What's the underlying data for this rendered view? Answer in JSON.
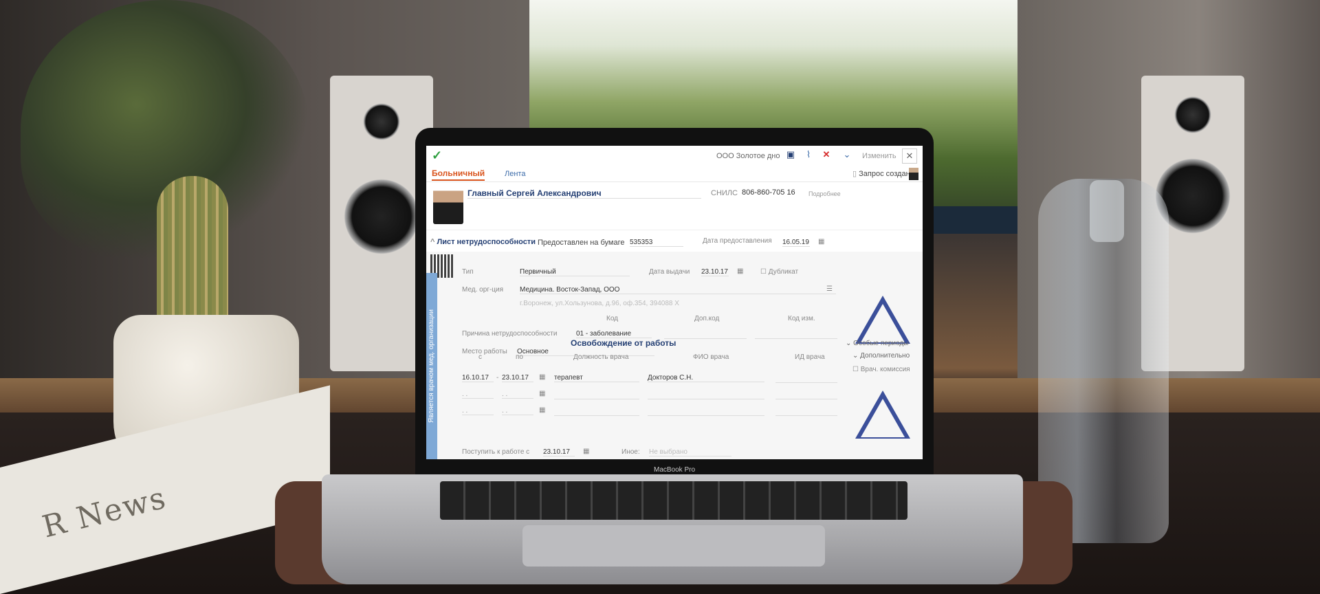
{
  "screen": {
    "toolbar": {
      "company": "ООО Золотое дно",
      "change_label": "Изменить"
    },
    "tabs": [
      {
        "label": "Больничный"
      },
      {
        "label": "Лента"
      }
    ],
    "status": "Запрос создан",
    "patient": {
      "name": "Главный Сергей Александрович",
      "snils_label": "СНИЛС",
      "snils_value": "806-860-705 16",
      "more_label": "Подробнее"
    },
    "sick_leave": {
      "section_title": "Лист нетрудоспособности",
      "paper_label": "Предоставлен на бумаге",
      "paper_value": "535353",
      "date_provided_label": "Дата предоставления",
      "date_provided_value": "16.05.19",
      "type_label": "Тип",
      "type_value": "Первичный",
      "issue_date_label": "Дата выдачи",
      "issue_date_value": "23.10.17",
      "duplicate_label": "Дубликат",
      "med_org_label": "Мед. орг-ция",
      "med_org_value": "Медицина. Восток-Запад, ООО",
      "address": "г.Воронеж, ул.Хользунова, д.96, оф.354, 394088 Х",
      "code_label": "Код",
      "addcode_label": "Доп.код",
      "codechange_label": "Код изм.",
      "reason_label": "Причина нетрудоспособности",
      "reason_value": "01 - заболевание",
      "workplace_label": "Место работы",
      "workplace_value": "Основное",
      "additional_label": "Дополнительно",
      "side_band": "Является врачом мед. организации"
    },
    "release": {
      "title": "Освобождение от работы",
      "special_periods_label": "Особые периоды",
      "from_label": "с",
      "to_label": "по",
      "position_label": "Должность врача",
      "doctor_label": "ФИО врача",
      "doctor_id_label": "ИД врача",
      "commission_label": "Врач. комиссия",
      "row1_from": "16.10.17",
      "row1_to": "23.10.17",
      "row1_position": "терапевт",
      "row1_doctor": "Докторов С.Н.",
      "empty_date": ". .",
      "return_label": "Поступить к работе с",
      "return_value": "23.10.17",
      "other_label": "Иное:",
      "other_value": "Не выбрано"
    }
  },
  "laptop": {
    "brand": "MacBook Pro"
  },
  "newspaper": {
    "masthead": "R News"
  }
}
